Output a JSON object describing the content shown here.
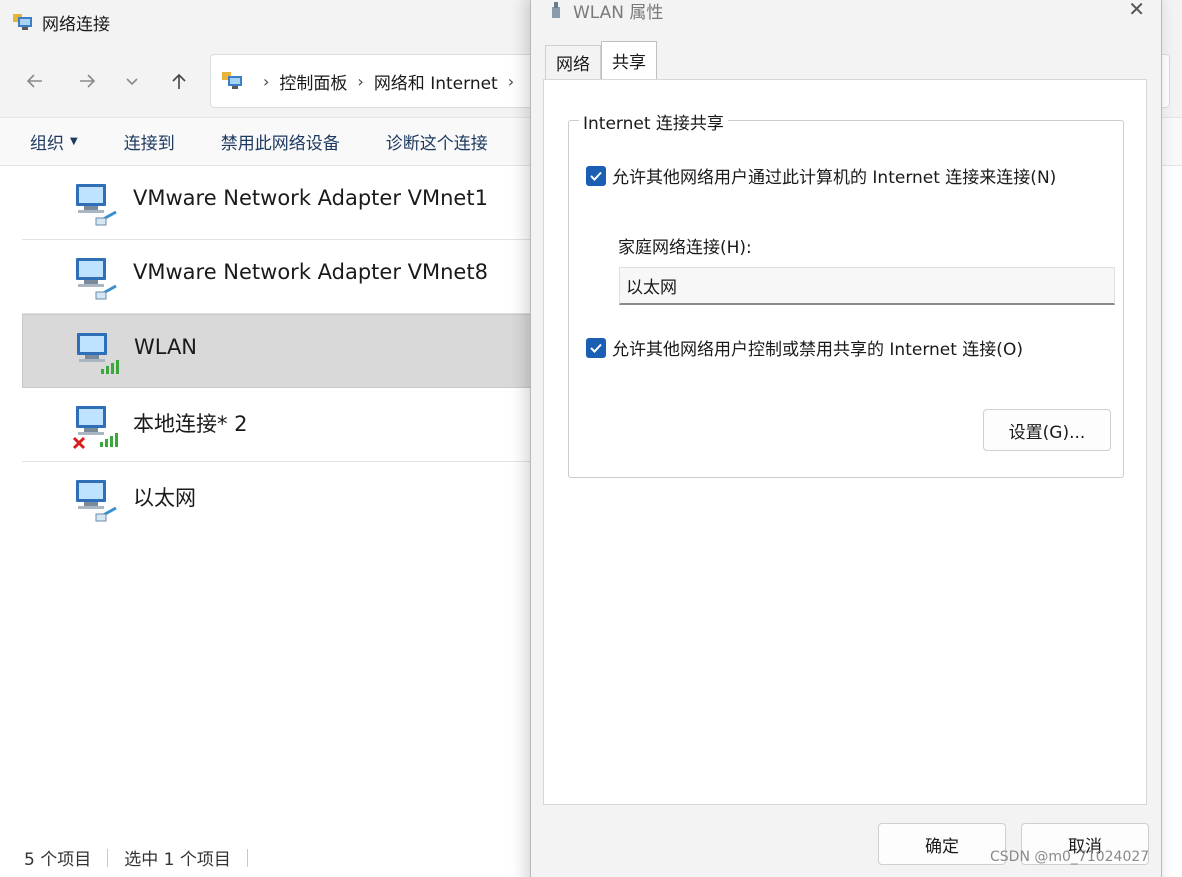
{
  "explorer": {
    "title": "网络连接",
    "breadcrumb": [
      "控制面板",
      "网络和 Internet"
    ],
    "commands": {
      "organize": "组织",
      "connect_to": "连接到",
      "disable_device": "禁用此网络设备",
      "diagnose": "诊断这个连接"
    },
    "connections": [
      {
        "name": "VMware Network Adapter VMnet1",
        "type": "wired"
      },
      {
        "name": "VMware Network Adapter VMnet8",
        "type": "wired"
      },
      {
        "name": "WLAN",
        "type": "wireless",
        "selected": true
      },
      {
        "name": "本地连接* 2",
        "type": "wireless-disconnected"
      },
      {
        "name": "以太网",
        "type": "wired"
      }
    ],
    "status": {
      "item_count": "5 个项目",
      "selected_count": "选中 1 个项目"
    }
  },
  "dialog": {
    "title": "WLAN 属性",
    "tabs": [
      {
        "label": "网络",
        "active": false
      },
      {
        "label": "共享",
        "active": true
      }
    ],
    "group_title": "Internet 连接共享",
    "allow_share": {
      "label": "允许其他网络用户通过此计算机的 Internet 连接来连接(N)",
      "checked": true
    },
    "home_label": "家庭网络连接(H):",
    "home_value": "以太网",
    "allow_control": {
      "label": "允许其他网络用户控制或禁用共享的 Internet 连接(O)",
      "checked": true
    },
    "settings_button": "设置(G)...",
    "ok_button": "确定",
    "cancel_button": "取消"
  },
  "watermark": "CSDN @m0_71024027",
  "colors": {
    "accent": "#1a5fb4",
    "selected_row": "#d9d9d9"
  }
}
